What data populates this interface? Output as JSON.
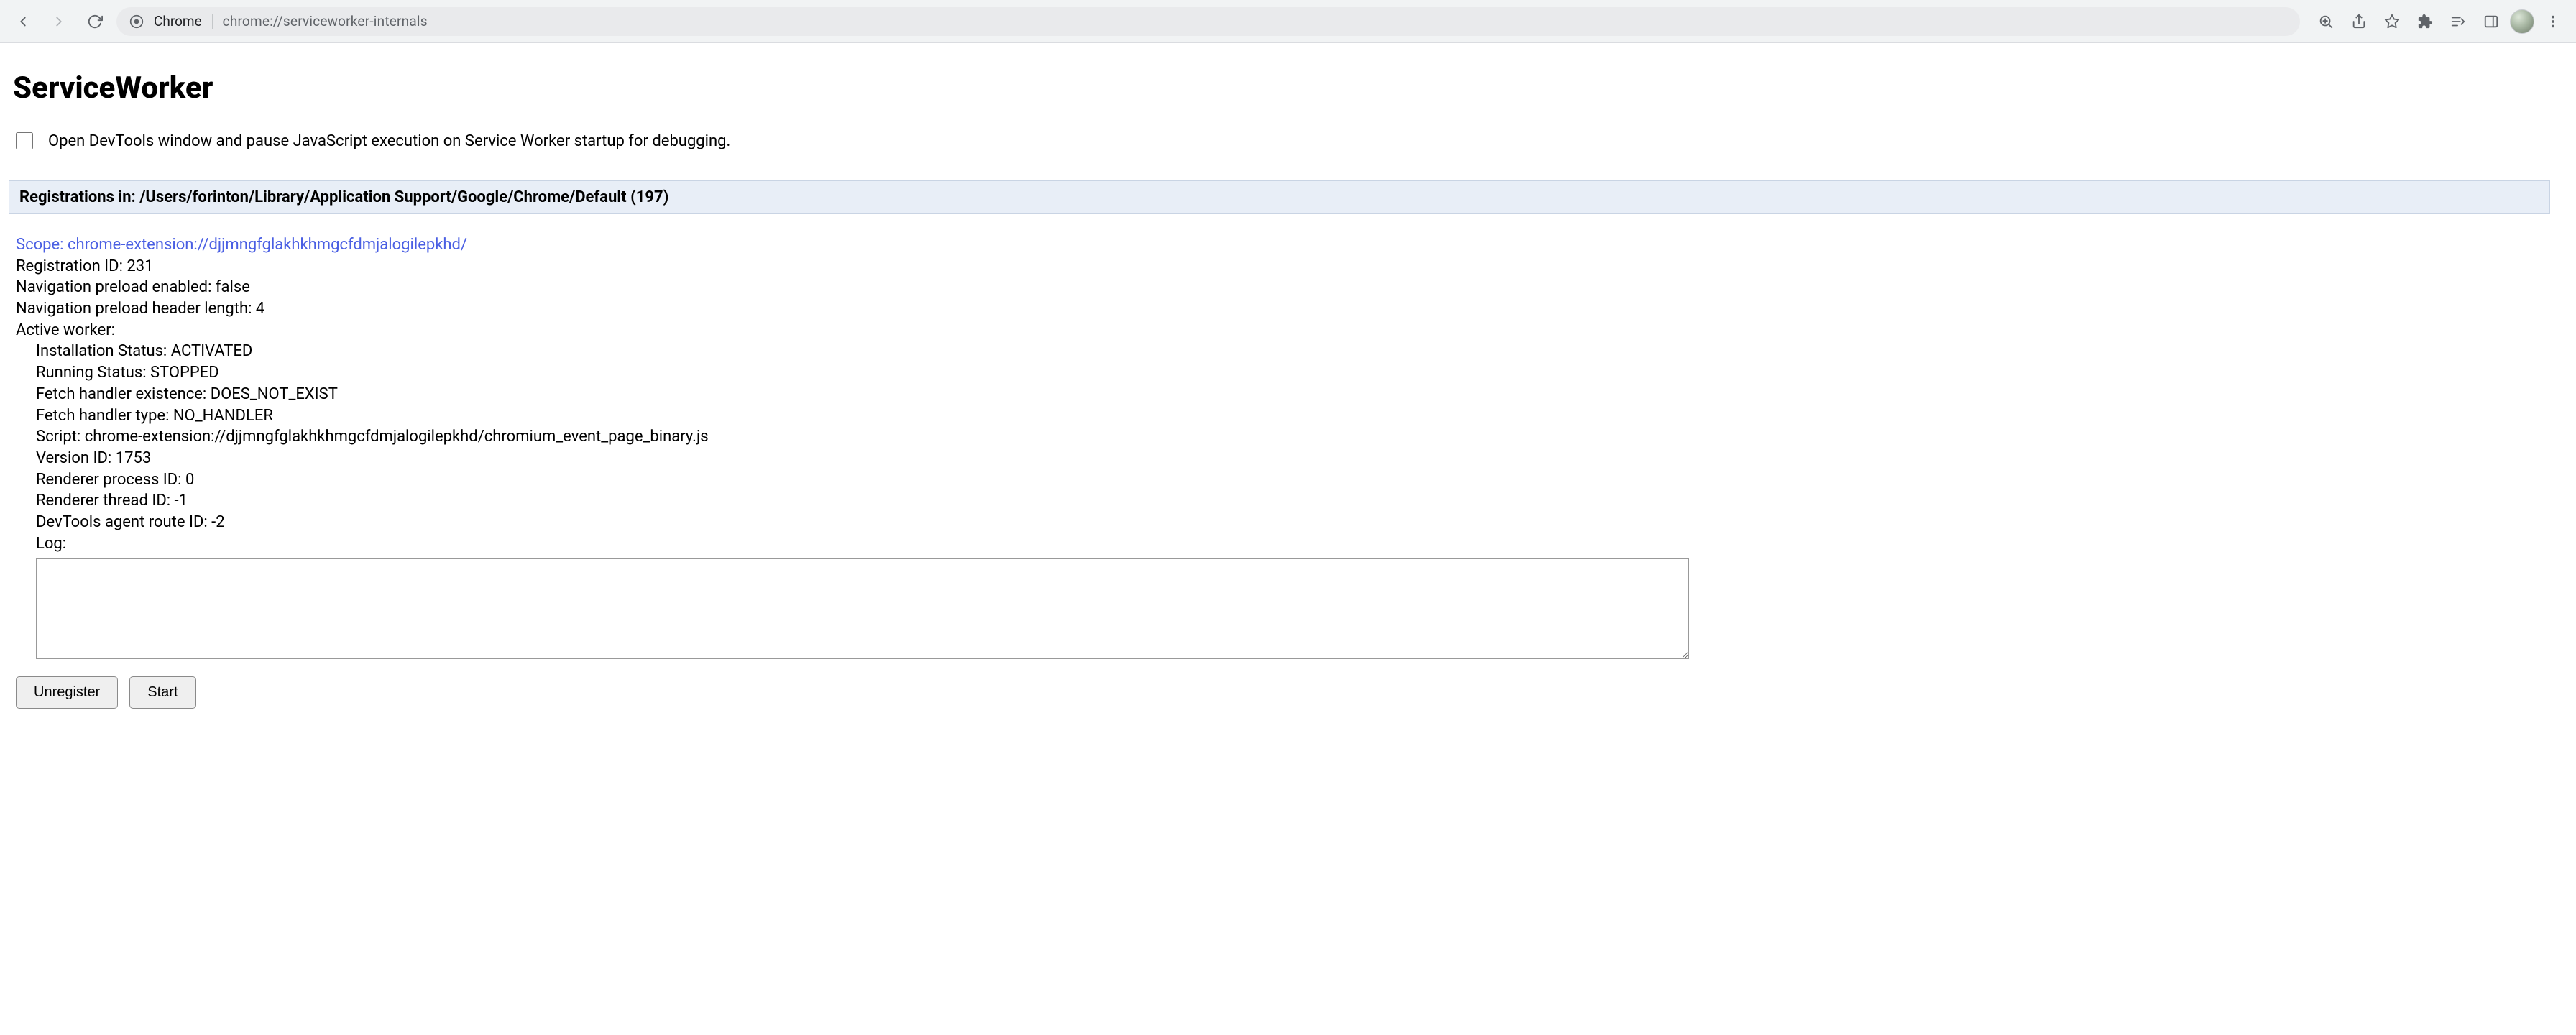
{
  "browser": {
    "site_name": "Chrome",
    "url": "chrome://serviceworker-internals"
  },
  "page": {
    "title": "ServiceWorker",
    "debug_checkbox_label": "Open DevTools window and pause JavaScript execution on Service Worker startup for debugging.",
    "registrations_header": "Registrations in: /Users/forinton/Library/Application Support/Google/Chrome/Default (197)"
  },
  "registration": {
    "scope_label": "Scope: ",
    "scope_url": "chrome-extension://djjmngfglakhkhmgcfdmjalogilepkhd/",
    "lines": {
      "reg_id": "Registration ID: 231",
      "nav_preload_enabled": "Navigation preload enabled: false",
      "nav_preload_header_len": "Navigation preload header length: 4",
      "active_worker": "Active worker:"
    },
    "worker": {
      "install_status": "Installation Status: ACTIVATED",
      "running_status": "Running Status: STOPPED",
      "fetch_existence": "Fetch handler existence: DOES_NOT_EXIST",
      "fetch_type": "Fetch handler type: NO_HANDLER",
      "script": "Script: chrome-extension://djjmngfglakhkhmgcfdmjalogilepkhd/chromium_event_page_binary.js",
      "version_id": "Version ID: 1753",
      "renderer_pid": "Renderer process ID: 0",
      "renderer_tid": "Renderer thread ID: -1",
      "devtools_route": "DevTools agent route ID: -2",
      "log_label": "Log:"
    },
    "log_value": ""
  },
  "buttons": {
    "unregister": "Unregister",
    "start": "Start"
  }
}
